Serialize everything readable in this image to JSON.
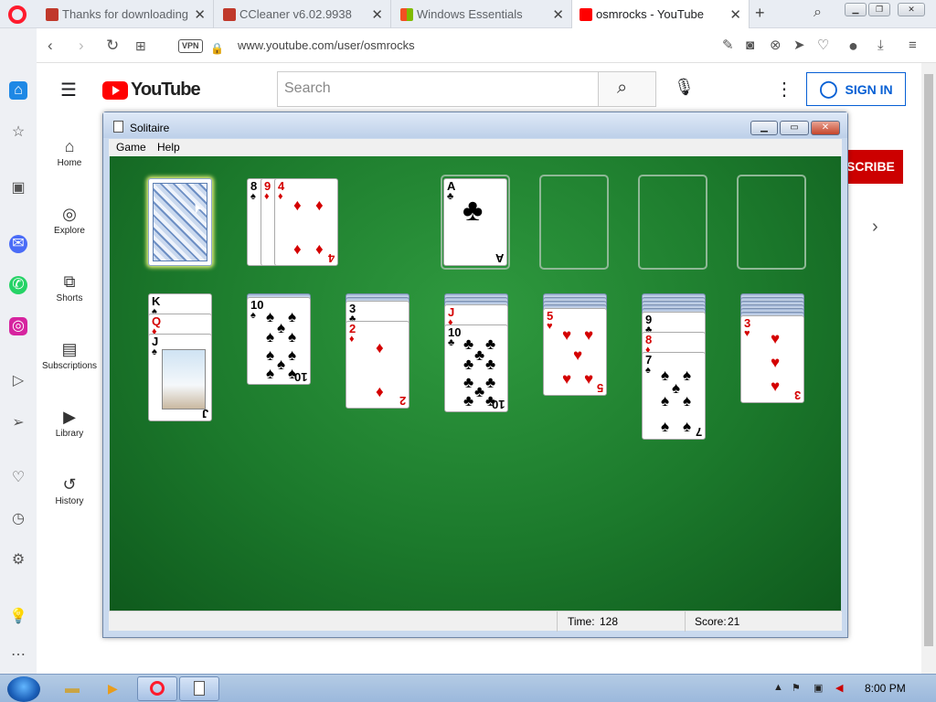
{
  "browser": {
    "tabs": [
      {
        "title": "Thanks for downloading CCleaner",
        "favicon_color": "#c0392b"
      },
      {
        "title": "CCleaner v6.02.9938",
        "favicon_color": "#c0392b"
      },
      {
        "title": "Windows Essentials",
        "favicon_color": "#2a7fd4"
      },
      {
        "title": "osmrocks - YouTube",
        "favicon_color": "#ff0000"
      }
    ],
    "new_tab_label": "+",
    "vpn_label": "VPN",
    "url": "www.youtube.com/user/osmrocks",
    "accent": "#ff1b2d"
  },
  "youtube": {
    "brand": "YouTube",
    "search_placeholder": "Search",
    "signin_label": "SIGN IN",
    "subscribe_label": "SCRIBE",
    "nav": [
      {
        "label": "Home",
        "icon": "home-icon"
      },
      {
        "label": "Explore",
        "icon": "compass-icon"
      },
      {
        "label": "Shorts",
        "icon": "shorts-icon"
      },
      {
        "label": "Subscriptions",
        "icon": "subscriptions-icon"
      },
      {
        "label": "Library",
        "icon": "library-icon"
      },
      {
        "label": "History",
        "icon": "history-icon"
      }
    ]
  },
  "solitaire": {
    "title": "Solitaire",
    "menu": [
      "Game",
      "Help"
    ],
    "time_label": "Time:",
    "time_value": "128",
    "score_label": "Score:",
    "score_value": "21",
    "felt_color": "#1c7a2c",
    "waste": [
      {
        "rank": "8",
        "suit": "♠"
      },
      {
        "rank": "9",
        "suit": "♦"
      },
      {
        "rank": "4",
        "suit": "♦"
      }
    ],
    "foundation": [
      {
        "rank": "A",
        "suit": "♣"
      }
    ],
    "tableau": [
      {
        "face_down": 0,
        "cards": [
          {
            "rank": "K",
            "suit": "♠"
          },
          {
            "rank": "Q",
            "suit": "♦"
          },
          {
            "rank": "J",
            "suit": "♠"
          }
        ]
      },
      {
        "face_down": 1,
        "cards": [
          {
            "rank": "10",
            "suit": "♠"
          }
        ]
      },
      {
        "face_down": 2,
        "cards": [
          {
            "rank": "3",
            "suit": "♣"
          },
          {
            "rank": "2",
            "suit": "♦"
          }
        ]
      },
      {
        "face_down": 3,
        "cards": [
          {
            "rank": "J",
            "suit": "♦"
          },
          {
            "rank": "10",
            "suit": "♣"
          }
        ]
      },
      {
        "face_down": 4,
        "cards": [
          {
            "rank": "5",
            "suit": "♥"
          }
        ]
      },
      {
        "face_down": 5,
        "cards": [
          {
            "rank": "9",
            "suit": "♣"
          },
          {
            "rank": "8",
            "suit": "♦"
          },
          {
            "rank": "7",
            "suit": "♠"
          }
        ]
      },
      {
        "face_down": 6,
        "cards": [
          {
            "rank": "3",
            "suit": "♥"
          }
        ]
      }
    ]
  },
  "taskbar": {
    "clock": "8:00 PM"
  }
}
